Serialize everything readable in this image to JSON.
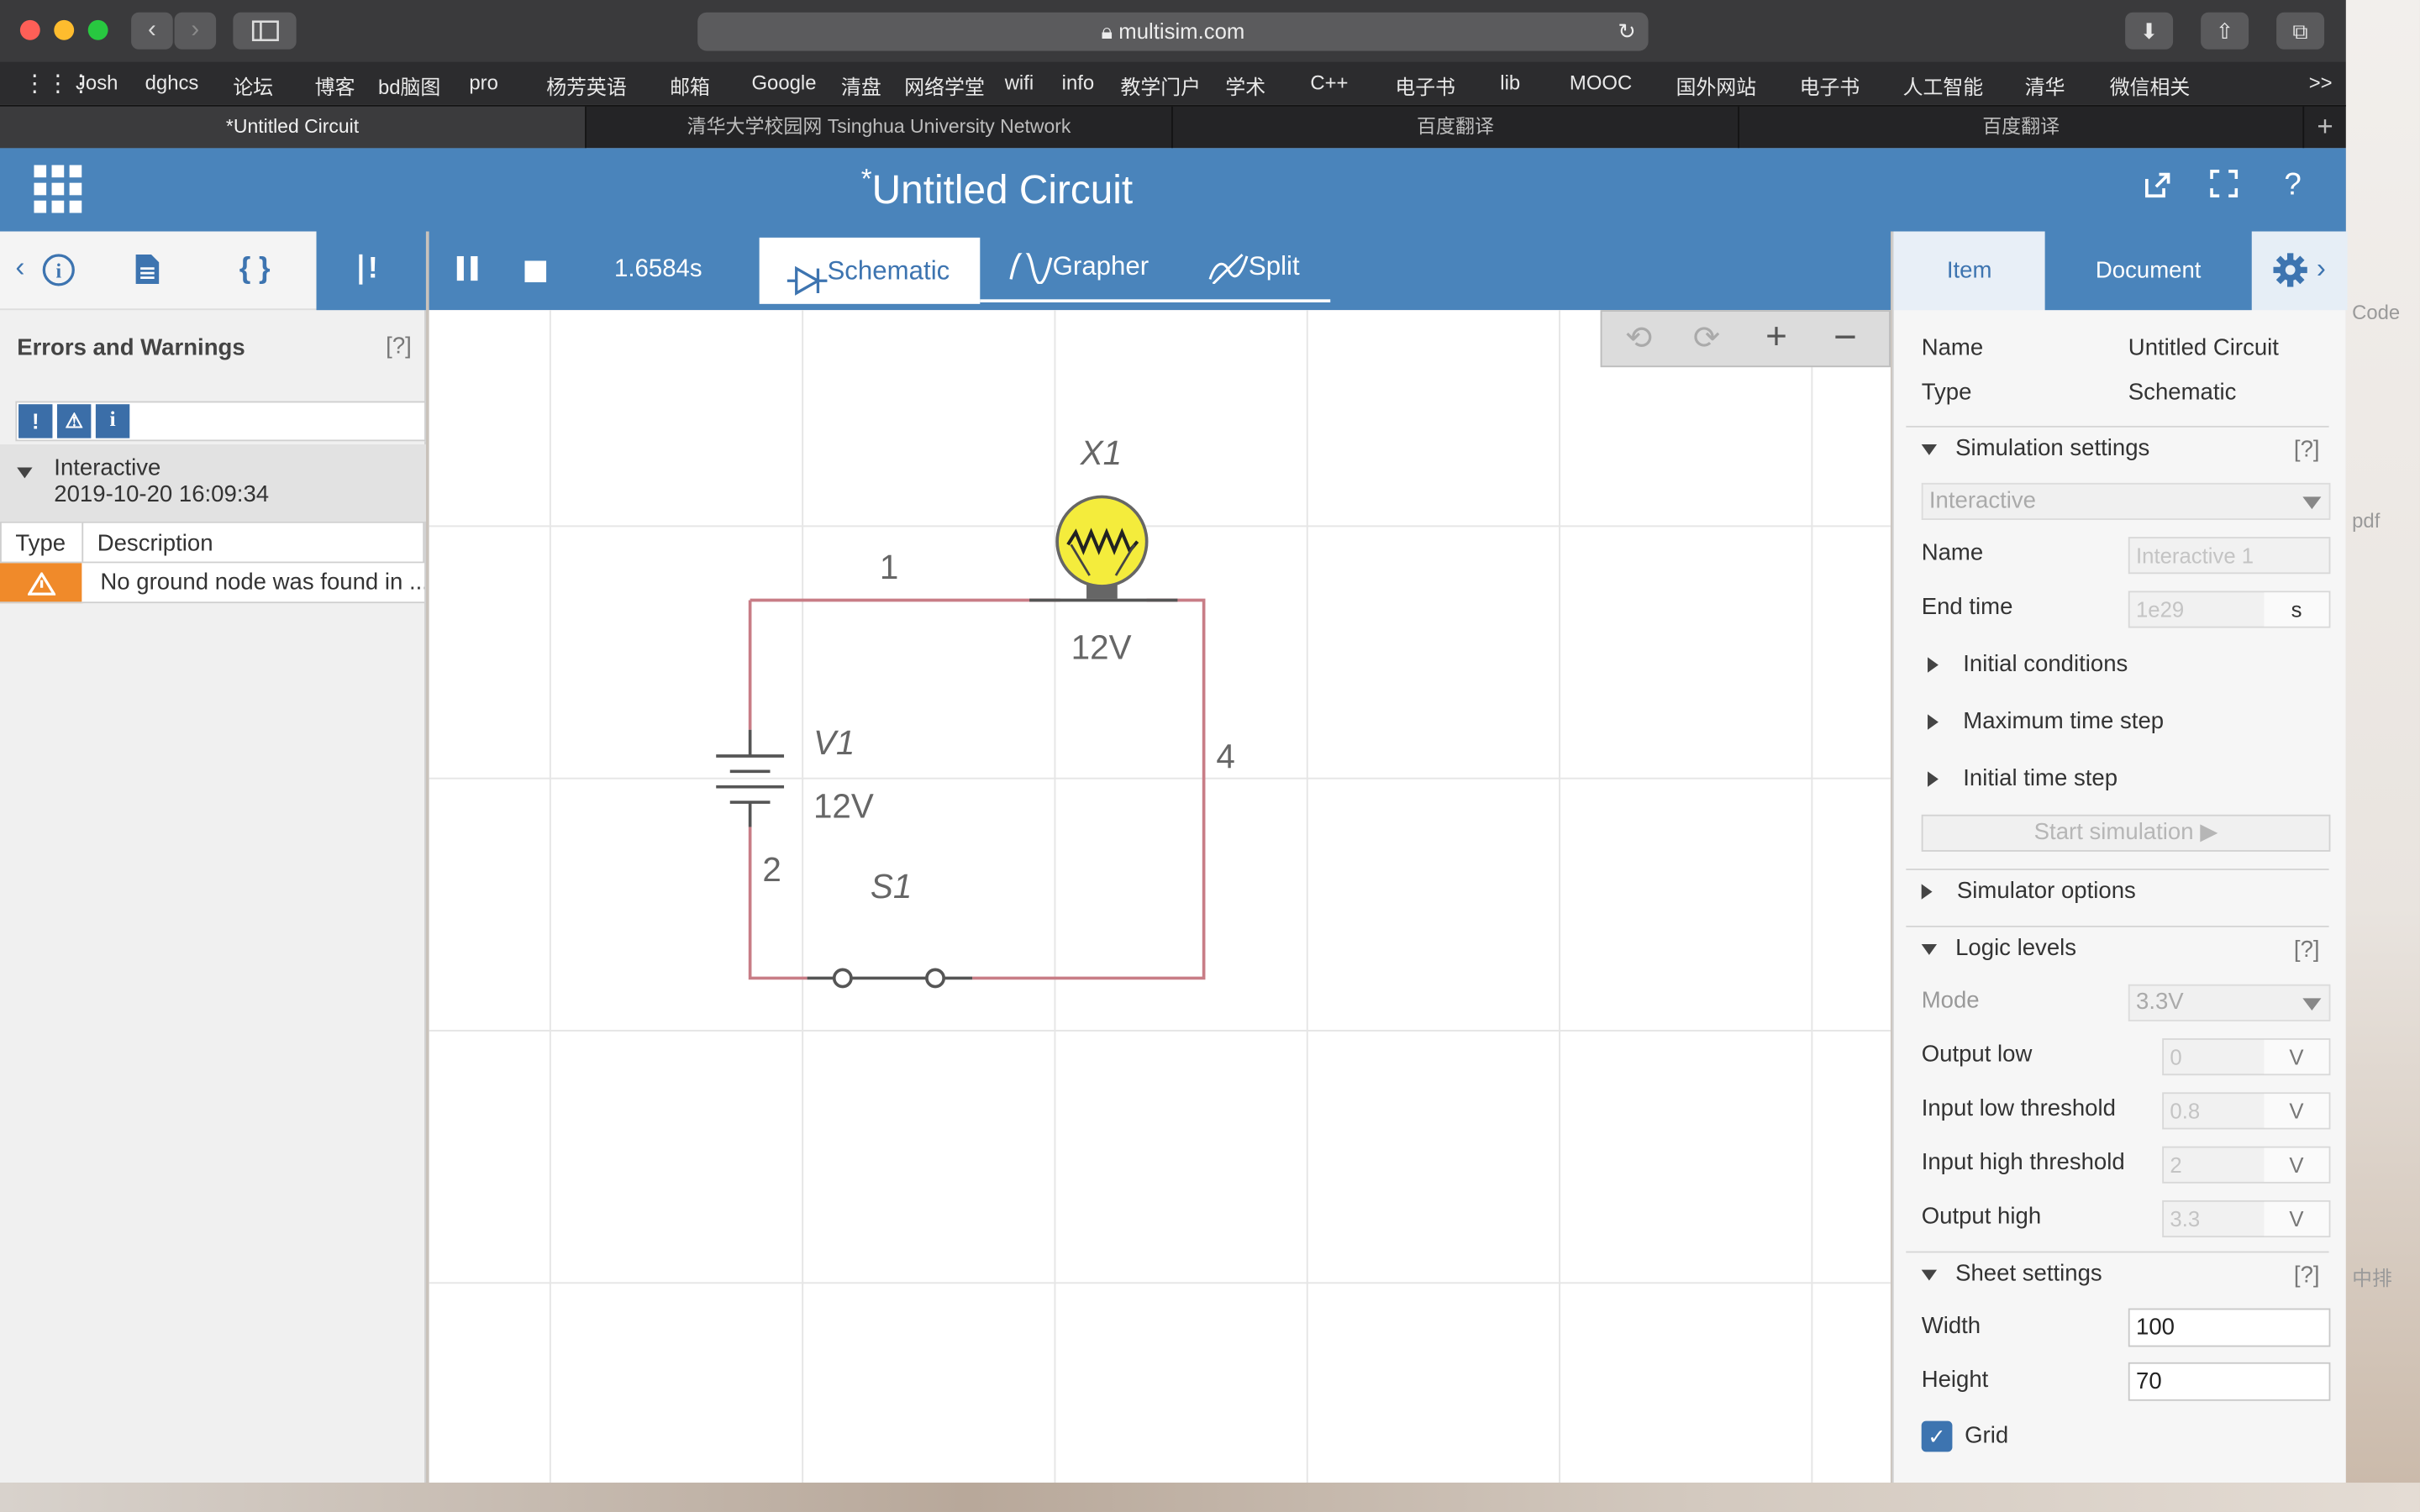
{
  "browser": {
    "url": "multisim.com",
    "bookmarks": [
      "Josh",
      "dghcs",
      "论坛",
      "博客",
      "bd脑图",
      "pro",
      "杨芳英语",
      "邮箱",
      "Google",
      "清盘",
      "网络学堂",
      "wifi",
      "info",
      "教学门户",
      "学术",
      "C++",
      "电子书",
      "lib",
      "MOOC",
      "国外网站",
      "电子书",
      "人工智能",
      "清华",
      "微信相关"
    ],
    "bookmark_more": ">>",
    "tabs": [
      "*Untitled Circuit",
      "清华大学校园网 Tsinghua University Network",
      "百度翻译",
      "百度翻译"
    ]
  },
  "app": {
    "title_prefix": "*",
    "title": "Untitled Circuit"
  },
  "left_panel": {
    "heading": "Errors and Warnings",
    "help": "[?]",
    "filters": [
      "!",
      "⚠",
      "i"
    ],
    "group_title": "Interactive",
    "group_time": "2019-10-20 16:09:34",
    "columns": [
      "Type",
      "Description"
    ],
    "rows": [
      {
        "type_icon": "warning-icon",
        "description": "No ground node was found in ..."
      }
    ]
  },
  "sim_toolbar": {
    "time": "1.6584s",
    "tabs": [
      "Schematic",
      "Grapher",
      "Split"
    ]
  },
  "schematic": {
    "lamp_ref": "X1",
    "lamp_value": "12V",
    "source_ref": "V1",
    "source_value": "12V",
    "switch_ref": "S1",
    "nets": [
      "1",
      "2",
      "4"
    ]
  },
  "right_panel": {
    "tabs": [
      "Item",
      "Document"
    ],
    "name_label": "Name",
    "name_value": "Untitled Circuit",
    "type_label": "Type",
    "type_value": "Schematic",
    "sim_settings": "Simulation settings",
    "help": "[?]",
    "analysis": "Interactive",
    "sim_name_label": "Name",
    "sim_name_placeholder": "Interactive 1",
    "end_time_label": "End time",
    "end_time_value": "1e29",
    "end_time_unit": "s",
    "initial_conditions": "Initial conditions",
    "max_time_step": "Maximum time step",
    "initial_time_step": "Initial time step",
    "start_simulation": "Start simulation",
    "simulator_options": "Simulator options",
    "logic_levels": "Logic levels",
    "mode_label": "Mode",
    "mode_value": "3.3V",
    "output_low_label": "Output low",
    "output_low_value": "0",
    "input_low_label": "Input low threshold",
    "input_low_value": "0.8",
    "input_high_label": "Input high threshold",
    "input_high_value": "2",
    "output_high_label": "Output high",
    "output_high_value": "3.3",
    "volt_unit": "V",
    "sheet_settings": "Sheet settings",
    "width_label": "Width",
    "width_value": "100",
    "height_label": "Height",
    "height_value": "70",
    "grid_label": "Grid",
    "grid_checked": true
  },
  "desktop_labels": [
    "Code",
    "pdf",
    "中排"
  ],
  "colors": {
    "accent": "#4a84bb",
    "wire": "#c87d86",
    "warning": "#f08a2a",
    "lamp": "#f4ec3c"
  }
}
